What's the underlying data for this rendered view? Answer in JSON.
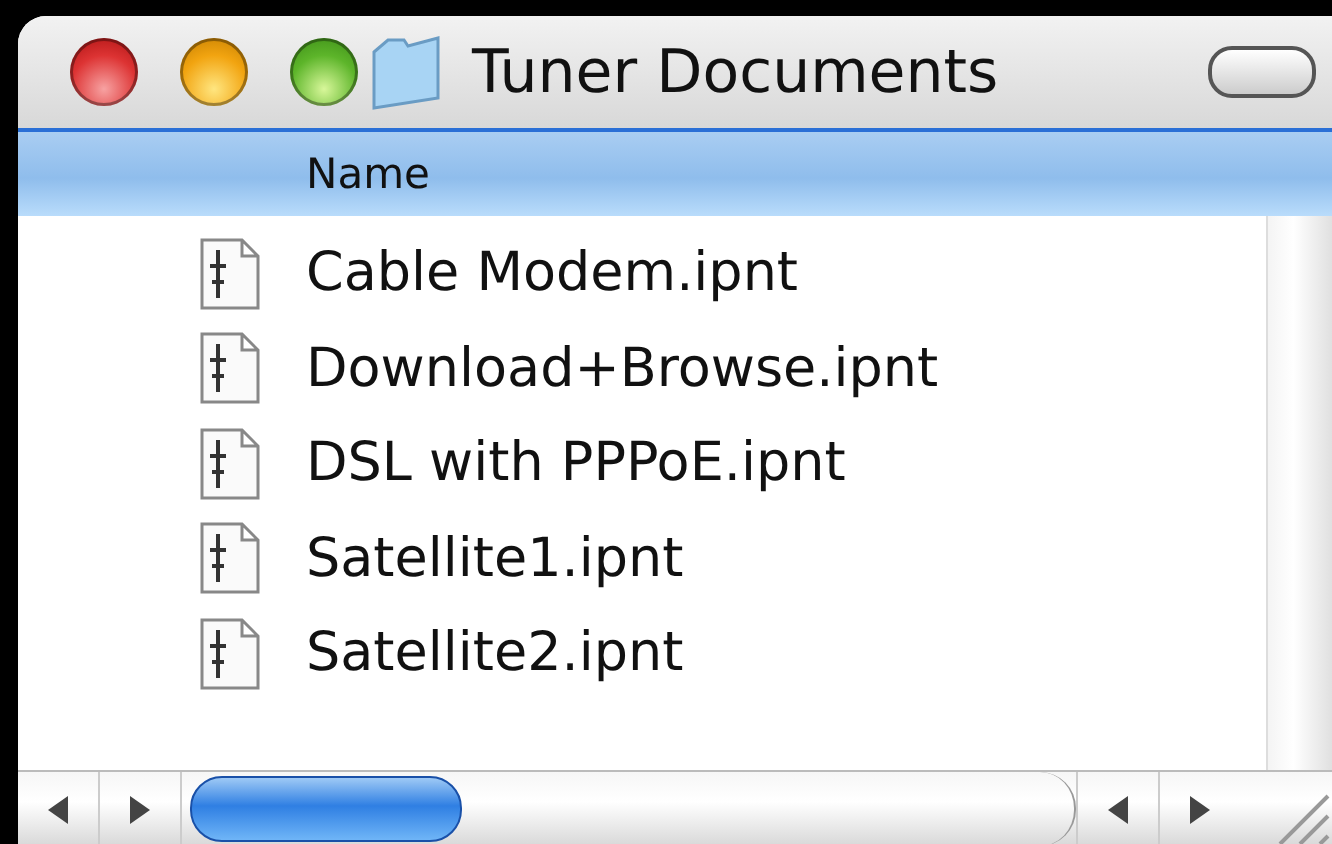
{
  "window": {
    "title": "Tuner Documents"
  },
  "list": {
    "columns": [
      "Name"
    ],
    "files": [
      {
        "name": "Cable Modem.ipnt"
      },
      {
        "name": "Download+Browse.ipnt"
      },
      {
        "name": "DSL with PPPoE.ipnt"
      },
      {
        "name": "Satellite1.ipnt"
      },
      {
        "name": "Satellite2.ipnt"
      }
    ]
  }
}
